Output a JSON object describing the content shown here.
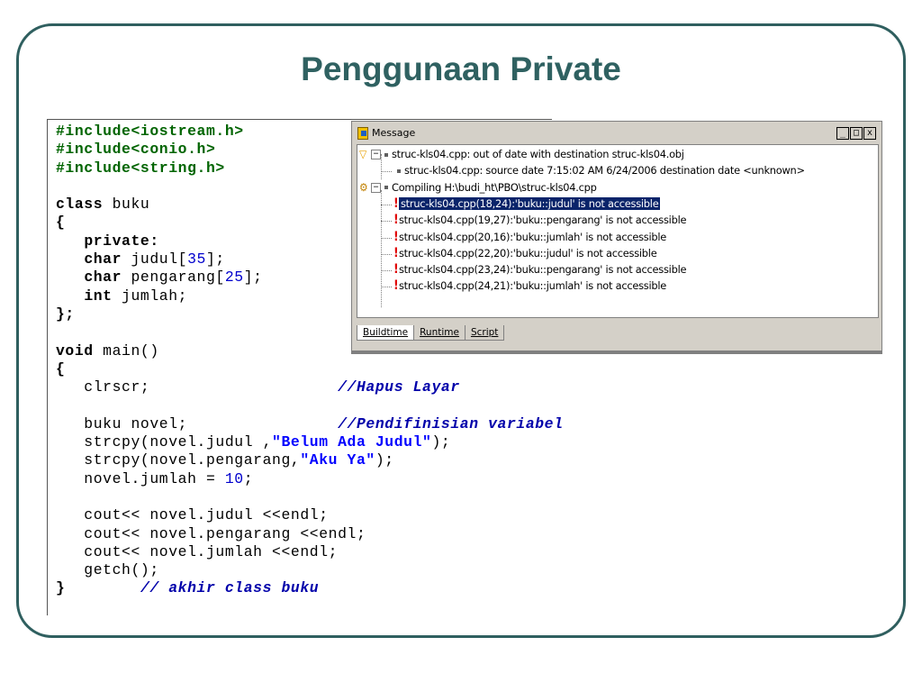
{
  "slide": {
    "title": "Penggunaan Private"
  },
  "code_lines": [
    {
      "segments": [
        {
          "t": "#include<iostream.h>",
          "c": "pp"
        }
      ]
    },
    {
      "segments": [
        {
          "t": "#include<conio.h>",
          "c": "pp"
        }
      ]
    },
    {
      "segments": [
        {
          "t": "#include<string.h>",
          "c": "pp"
        }
      ]
    },
    {
      "segments": [
        {
          "t": "",
          "c": ""
        }
      ]
    },
    {
      "segments": [
        {
          "t": "class",
          "c": "kw"
        },
        {
          "t": " buku",
          "c": ""
        }
      ]
    },
    {
      "segments": [
        {
          "t": "{",
          "c": "b"
        }
      ]
    },
    {
      "segments": [
        {
          "t": "   ",
          "c": ""
        },
        {
          "t": "private:",
          "c": "kw"
        }
      ]
    },
    {
      "segments": [
        {
          "t": "   ",
          "c": ""
        },
        {
          "t": "char",
          "c": "kw"
        },
        {
          "t": " judul[",
          "c": ""
        },
        {
          "t": "35",
          "c": "num"
        },
        {
          "t": "];",
          "c": ""
        }
      ]
    },
    {
      "segments": [
        {
          "t": "   ",
          "c": ""
        },
        {
          "t": "char",
          "c": "kw"
        },
        {
          "t": " pengarang[",
          "c": ""
        },
        {
          "t": "25",
          "c": "num"
        },
        {
          "t": "];",
          "c": ""
        }
      ]
    },
    {
      "segments": [
        {
          "t": "   ",
          "c": ""
        },
        {
          "t": "int",
          "c": "kw"
        },
        {
          "t": " jumlah;",
          "c": ""
        }
      ]
    },
    {
      "segments": [
        {
          "t": "};",
          "c": "b"
        }
      ]
    },
    {
      "segments": [
        {
          "t": "",
          "c": ""
        }
      ]
    },
    {
      "segments": [
        {
          "t": "void",
          "c": "kw"
        },
        {
          "t": " main()",
          "c": ""
        }
      ]
    },
    {
      "segments": [
        {
          "t": "{",
          "c": "b"
        }
      ]
    },
    {
      "segments": [
        {
          "t": "   clrscr;                    ",
          "c": ""
        },
        {
          "t": "//Hapus Layar",
          "c": "cm"
        }
      ]
    },
    {
      "segments": [
        {
          "t": "",
          "c": ""
        }
      ]
    },
    {
      "segments": [
        {
          "t": "   buku novel;                ",
          "c": ""
        },
        {
          "t": "//Pendifinisian variabel",
          "c": "cm"
        }
      ]
    },
    {
      "segments": [
        {
          "t": "   strcpy(novel.judul ,",
          "c": ""
        },
        {
          "t": "\"Belum Ada Judul\"",
          "c": "str"
        },
        {
          "t": ");",
          "c": ""
        }
      ]
    },
    {
      "segments": [
        {
          "t": "   strcpy(novel.pengarang,",
          "c": ""
        },
        {
          "t": "\"Aku Ya\"",
          "c": "str"
        },
        {
          "t": ");",
          "c": ""
        }
      ]
    },
    {
      "segments": [
        {
          "t": "   novel.jumlah = ",
          "c": ""
        },
        {
          "t": "10",
          "c": "num"
        },
        {
          "t": ";",
          "c": ""
        }
      ]
    },
    {
      "segments": [
        {
          "t": "",
          "c": ""
        }
      ]
    },
    {
      "segments": [
        {
          "t": "   cout<< novel.judul <<endl;",
          "c": ""
        }
      ]
    },
    {
      "segments": [
        {
          "t": "   cout<< novel.pengarang <<endl;",
          "c": ""
        }
      ]
    },
    {
      "segments": [
        {
          "t": "   cout<< novel.jumlah <<endl;",
          "c": ""
        }
      ]
    },
    {
      "segments": [
        {
          "t": "   getch();",
          "c": ""
        }
      ]
    },
    {
      "segments": [
        {
          "t": "}",
          "c": "b"
        },
        {
          "t": "        ",
          "c": ""
        },
        {
          "t": "// akhir class buku",
          "c": "cm"
        }
      ]
    }
  ],
  "message_window": {
    "title": "Message",
    "buttons": [
      "_",
      "□",
      "x"
    ],
    "messages": [
      {
        "level": 0,
        "kind": "warning",
        "text": "struc-kls04.cpp: out of date with destination struc-kls04.obj",
        "selected": false
      },
      {
        "level": 1,
        "kind": "info",
        "text": "struc-kls04.cpp: source date 7:15:02 AM 6/24/2006  destination date <unknown>",
        "selected": false
      },
      {
        "level": 0,
        "kind": "compile",
        "text": "Compiling H:\\budi_ht\\PBO\\struc-kls04.cpp",
        "selected": false
      },
      {
        "level": 1,
        "kind": "error",
        "text": "struc-kls04.cpp(18,24):'buku::judul' is not accessible",
        "selected": true
      },
      {
        "level": 1,
        "kind": "error",
        "text": "struc-kls04.cpp(19,27):'buku::pengarang' is not accessible",
        "selected": false
      },
      {
        "level": 1,
        "kind": "error",
        "text": "struc-kls04.cpp(20,16):'buku::jumlah' is not accessible",
        "selected": false
      },
      {
        "level": 1,
        "kind": "error",
        "text": "struc-kls04.cpp(22,20):'buku::judul' is not accessible",
        "selected": false
      },
      {
        "level": 1,
        "kind": "error",
        "text": "struc-kls04.cpp(23,24):'buku::pengarang' is not accessible",
        "selected": false
      },
      {
        "level": 1,
        "kind": "error",
        "text": "struc-kls04.cpp(24,21):'buku::jumlah' is not accessible",
        "selected": false
      }
    ],
    "tabs": [
      {
        "label": "Buildtime",
        "active": true
      },
      {
        "label": "Runtime",
        "active": false
      },
      {
        "label": "Script",
        "active": false
      }
    ]
  }
}
